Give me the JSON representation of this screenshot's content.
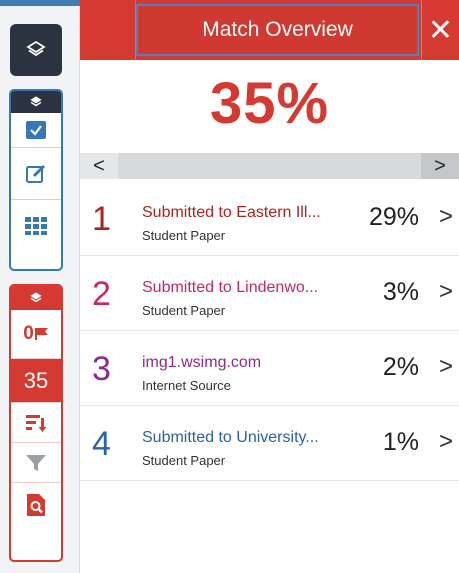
{
  "header": {
    "title": "Match Overview",
    "close_symbol": "✕"
  },
  "overall_percent": "35%",
  "scroll": {
    "left_arrow": "<",
    "right_arrow": ">"
  },
  "sidebar": {
    "flag_count": "0",
    "match_count": "35"
  },
  "matches": [
    {
      "rank": "1",
      "source": "Submitted to Eastern Ill...",
      "type": "Student Paper",
      "percent": "29%",
      "color": "#b0221d"
    },
    {
      "rank": "2",
      "source": "Submitted to Lindenwo...",
      "type": "Student Paper",
      "percent": "3%",
      "color": "#c6286a"
    },
    {
      "rank": "3",
      "source": "img1.wsimg.com",
      "type": "Internet Source",
      "percent": "2%",
      "color": "#8e2a8e"
    },
    {
      "rank": "4",
      "source": "Submitted to University...",
      "type": "Student Paper",
      "percent": "1%",
      "color": "#2a62a8"
    }
  ],
  "colors": {
    "brand_red": "#d43a31",
    "dark": "#2b3340",
    "blue": "#3478b8"
  }
}
